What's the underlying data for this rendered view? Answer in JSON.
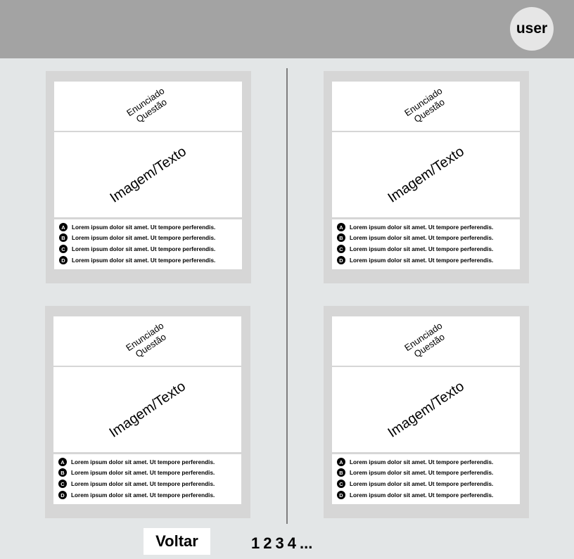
{
  "user": {
    "label": "user"
  },
  "cards": [
    {
      "statement": [
        "Enunciado",
        "Questão"
      ],
      "content": "Imagem/Texto",
      "options": [
        {
          "letter": "A",
          "text": "Lorem ipsum dolor sit amet. Ut tempore perferendis."
        },
        {
          "letter": "B",
          "text": "Lorem ipsum dolor sit amet. Ut tempore perferendis."
        },
        {
          "letter": "C",
          "text": "Lorem ipsum dolor sit amet. Ut tempore perferendis."
        },
        {
          "letter": "D",
          "text": "Lorem ipsum dolor sit amet. Ut tempore perferendis."
        }
      ]
    },
    {
      "statement": [
        "Enunciado",
        "Questão"
      ],
      "content": "Imagem/Texto",
      "options": [
        {
          "letter": "A",
          "text": "Lorem ipsum dolor sit amet. Ut tempore perferendis."
        },
        {
          "letter": "B",
          "text": "Lorem ipsum dolor sit amet. Ut tempore perferendis."
        },
        {
          "letter": "C",
          "text": "Lorem ipsum dolor sit amet. Ut tempore perferendis."
        },
        {
          "letter": "D",
          "text": "Lorem ipsum dolor sit amet. Ut tempore perferendis."
        }
      ]
    },
    {
      "statement": [
        "Enunciado",
        "Questão"
      ],
      "content": "Imagem/Texto",
      "options": [
        {
          "letter": "A",
          "text": "Lorem ipsum dolor sit amet. Ut tempore perferendis."
        },
        {
          "letter": "B",
          "text": "Lorem ipsum dolor sit amet. Ut tempore perferendis."
        },
        {
          "letter": "C",
          "text": "Lorem ipsum dolor sit amet. Ut tempore perferendis."
        },
        {
          "letter": "D",
          "text": "Lorem ipsum dolor sit amet. Ut tempore perferendis."
        }
      ]
    },
    {
      "statement": [
        "Enunciado",
        "Questão"
      ],
      "content": "Imagem/Texto",
      "options": [
        {
          "letter": "A",
          "text": "Lorem ipsum dolor sit amet. Ut tempore perferendis."
        },
        {
          "letter": "B",
          "text": "Lorem ipsum dolor sit amet. Ut tempore perferendis."
        },
        {
          "letter": "C",
          "text": "Lorem ipsum dolor sit amet. Ut tempore perferendis."
        },
        {
          "letter": "D",
          "text": "Lorem ipsum dolor sit amet. Ut tempore perferendis."
        }
      ]
    }
  ],
  "footer": {
    "back_label": "Voltar",
    "pages": [
      "1",
      "2",
      "3",
      "4",
      "..."
    ]
  }
}
